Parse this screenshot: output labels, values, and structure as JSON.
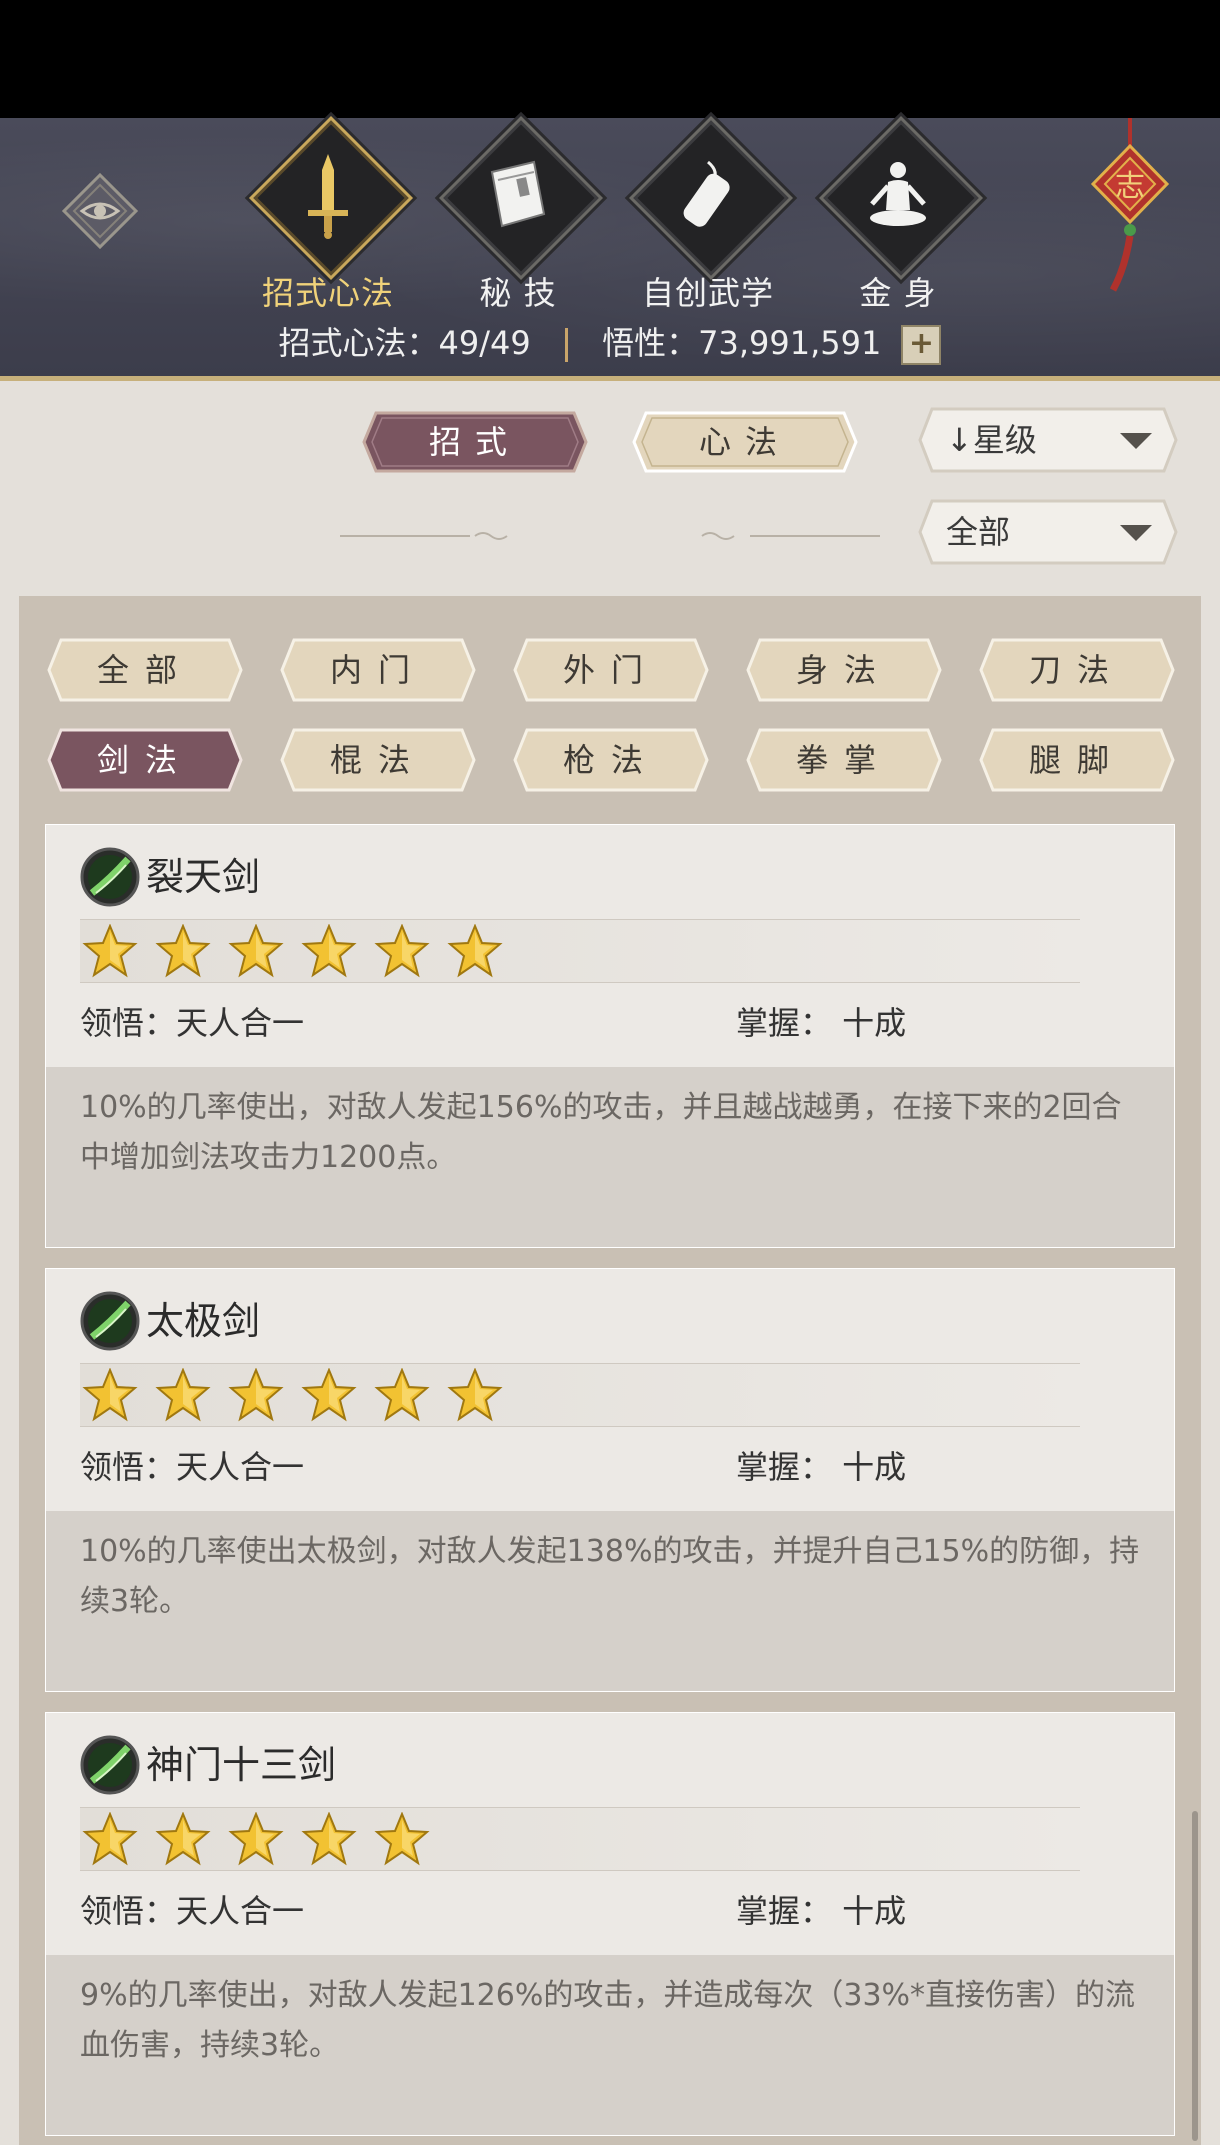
{
  "header": {
    "tabs": [
      {
        "label": "招式心法",
        "icon": "sword-icon",
        "active": true
      },
      {
        "label": "秘 技",
        "icon": "book-icon",
        "active": false
      },
      {
        "label": "自创武学",
        "icon": "scroll-icon",
        "active": false
      },
      {
        "label": "金 身",
        "icon": "meditation-icon",
        "active": false
      }
    ],
    "ornament_text": "志",
    "stats": {
      "moves_label": "招式心法：",
      "moves_value": "49/49",
      "insight_label": "悟性：",
      "insight_value": "73,991,591",
      "plus": "+"
    }
  },
  "toolbar": {
    "segments": [
      {
        "label": "招式",
        "active": true
      },
      {
        "label": "心法",
        "active": false
      }
    ],
    "sort_dropdown": {
      "label": "星级",
      "arrow": "↓"
    },
    "filter_dropdown": {
      "label": "全部"
    }
  },
  "categories": [
    {
      "label": "全部",
      "active": false
    },
    {
      "label": "内门",
      "active": false
    },
    {
      "label": "外门",
      "active": false
    },
    {
      "label": "身法",
      "active": false
    },
    {
      "label": "刀法",
      "active": false
    },
    {
      "label": "剑法",
      "active": true
    },
    {
      "label": "棍法",
      "active": false
    },
    {
      "label": "枪法",
      "active": false
    },
    {
      "label": "拳掌",
      "active": false
    },
    {
      "label": "腿脚",
      "active": false
    }
  ],
  "skills": [
    {
      "name": "裂天剑",
      "stars": 6,
      "comprehension": "领悟：天人合一",
      "mastery": "掌握：  十成",
      "description": "10%的几率使出，对敌人发起156%的攻击，并且越战越勇，在接下来的2回合中增加剑法攻击力1200点。"
    },
    {
      "name": "太极剑",
      "stars": 6,
      "comprehension": "领悟：天人合一",
      "mastery": "掌握：  十成",
      "description": "10%的几率使出太极剑，对敌人发起138%的攻击，并提升自己15%的防御，持续3轮。"
    },
    {
      "name": "神门十三剑",
      "stars": 5,
      "comprehension": "领悟：天人合一",
      "mastery": "掌握：  十成",
      "description": "9%的几率使出，对敌人发起126%的攻击，并造成每次（33%*直接伤害）的流血伤害，持续3轮。"
    }
  ],
  "colors": {
    "accent_gold": "#f0d27a",
    "active_chip": "#7a5560",
    "chip": "#e3d6bd",
    "header_bg": "#44455a"
  }
}
